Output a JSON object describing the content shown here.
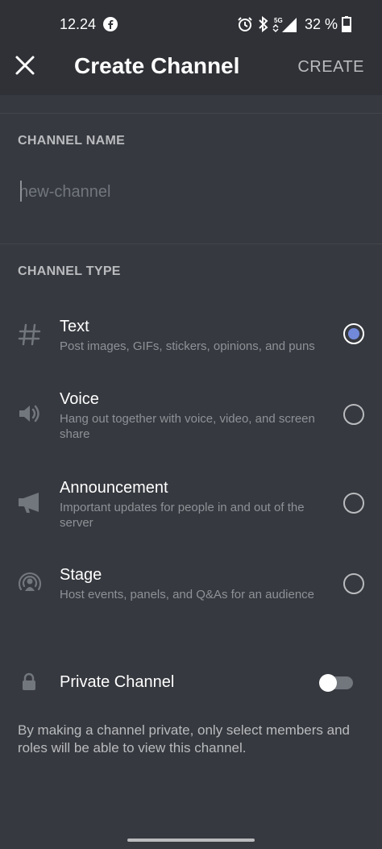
{
  "status_bar": {
    "time": "12.24",
    "battery": "32 %",
    "icons": [
      "facebook-icon",
      "alarm-icon",
      "bluetooth-icon",
      "5g-signal-icon",
      "battery-icon"
    ]
  },
  "header": {
    "title": "Create Channel",
    "create_label": "CREATE",
    "close_icon": "close-icon"
  },
  "channel_name": {
    "section_label": "CHANNEL NAME",
    "placeholder": "new-channel",
    "value": ""
  },
  "channel_type": {
    "section_label": "CHANNEL TYPE",
    "selected": "Text",
    "options": [
      {
        "icon": "hash-icon",
        "title": "Text",
        "description": "Post images, GIFs, stickers, opinions, and puns"
      },
      {
        "icon": "speaker-icon",
        "title": "Voice",
        "description": "Hang out together with voice, video, and screen share"
      },
      {
        "icon": "megaphone-icon",
        "title": "Announcement",
        "description": "Important updates for people in and out of the server"
      },
      {
        "icon": "stage-icon",
        "title": "Stage",
        "description": "Host events, panels, and Q&As for an audience"
      }
    ]
  },
  "private_channel": {
    "icon": "lock-icon",
    "label": "Private Channel",
    "enabled": false,
    "description": "By making a channel private, only select members and roles will be able to view this channel."
  },
  "colors": {
    "background": "#36393f",
    "header_background": "#2f3136",
    "accent": "#7289da"
  }
}
